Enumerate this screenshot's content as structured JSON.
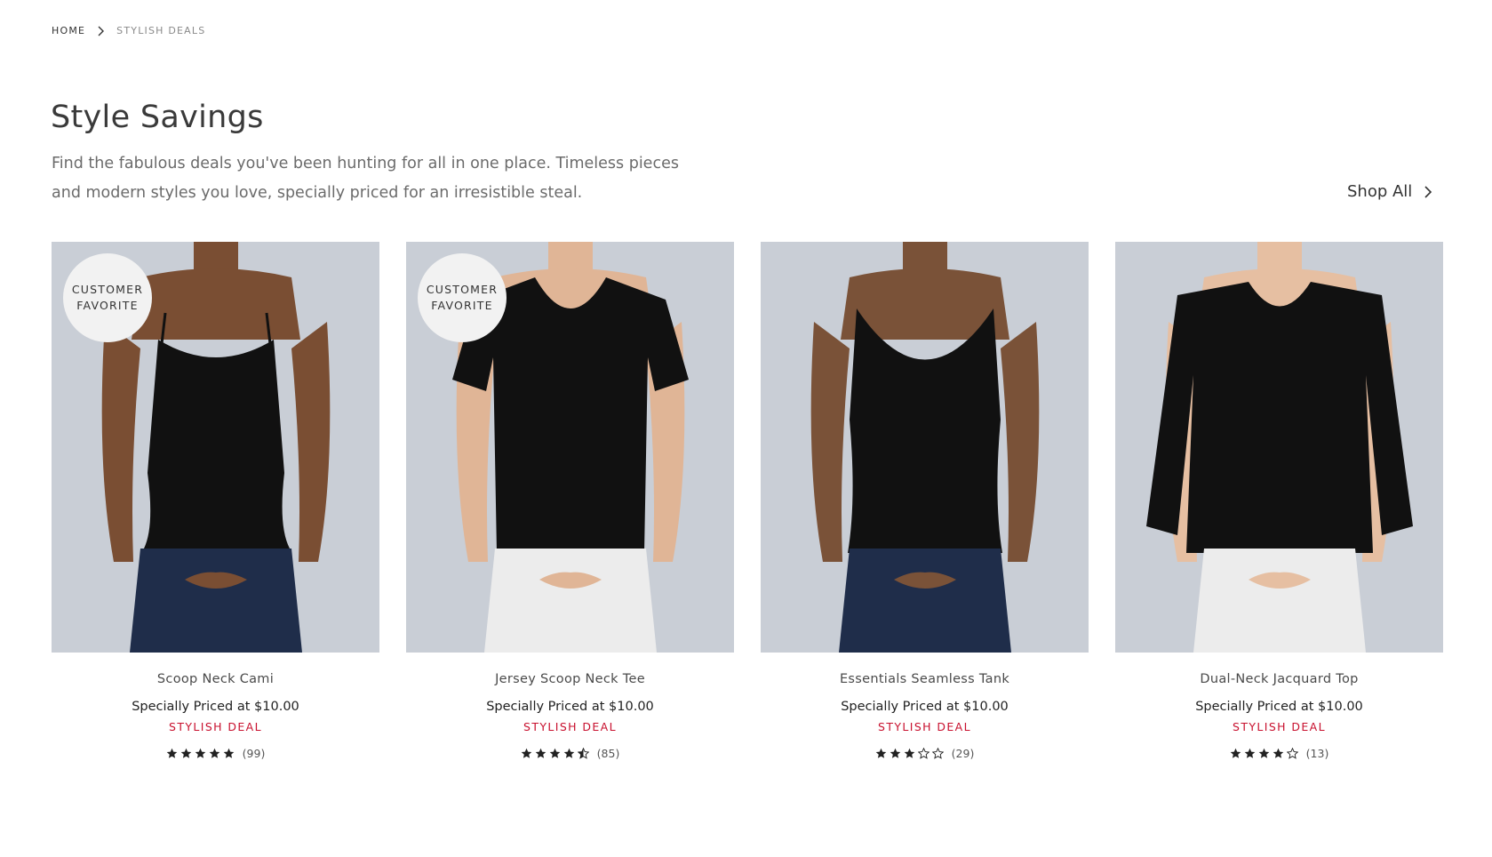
{
  "breadcrumb": {
    "home": "HOME",
    "current": "STYLISH DEALS"
  },
  "header": {
    "title": "Style Savings",
    "description": "Find the fabulous deals you've been hunting for all in one place. Timeless pieces and modern styles you love, specially priced for an irresistible steal.",
    "shop_all": "Shop All"
  },
  "colors": {
    "deal_red": "#c8102e",
    "image_bg": "#c9ced6"
  },
  "products": [
    {
      "badge": [
        "CUSTOMER",
        "FAVORITE"
      ],
      "name": "Scoop Neck Cami",
      "price": "Specially Priced at $10.00",
      "deal": "STYLISH DEAL",
      "rating": 5,
      "reviews": "(99)",
      "image": "woman-black-cami-jeans"
    },
    {
      "badge": [
        "CUSTOMER",
        "FAVORITE"
      ],
      "name": "Jersey Scoop Neck Tee",
      "price": "Specially Priced at $10.00",
      "deal": "STYLISH DEAL",
      "rating": 4.5,
      "reviews": "(85)",
      "image": "woman-black-tee-white-jeans"
    },
    {
      "badge": null,
      "name": "Essentials Seamless Tank",
      "price": "Specially Priced at $10.00",
      "deal": "STYLISH DEAL",
      "rating": 3,
      "reviews": "(29)",
      "image": "woman-black-tank-jeans"
    },
    {
      "badge": null,
      "name": "Dual-Neck Jacquard Top",
      "price": "Specially Priced at $10.00",
      "deal": "STYLISH DEAL",
      "rating": 4,
      "reviews": "(13)",
      "image": "woman-black-vneck-white-jeans"
    }
  ]
}
